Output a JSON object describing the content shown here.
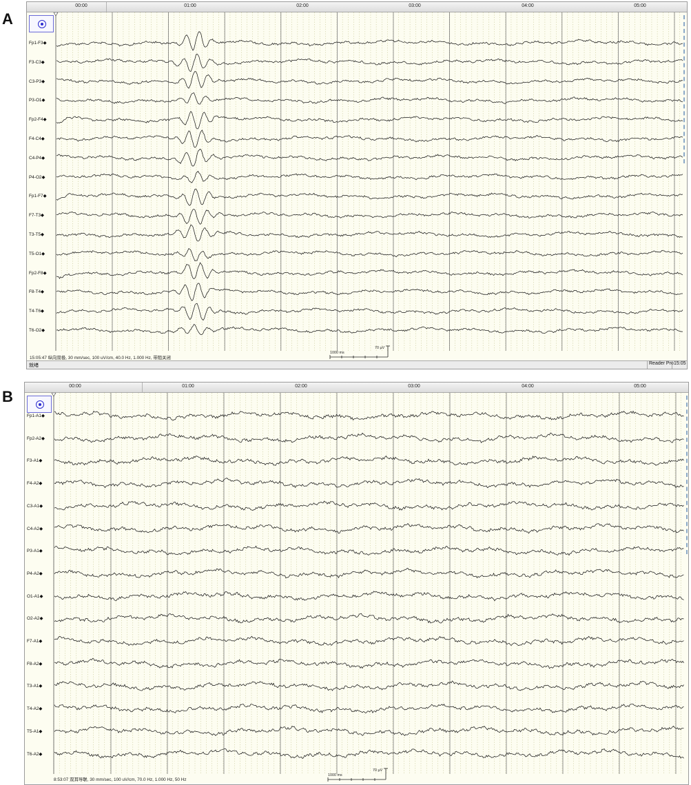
{
  "panel_a": {
    "label": "A",
    "time_ticks": [
      "00:00",
      "01:00",
      "02:00",
      "03:00",
      "04:00",
      "05:00"
    ],
    "channels": [
      "Fp1-F3◆",
      "F3-C3◆",
      "C3-P3◆",
      "P3-O1◆",
      "Fp2-F4◆",
      "F4-C4◆",
      "C4-P4◆",
      "P4-O2◆",
      "Fp1-F7◆",
      "F7-T3◆",
      "T3-T5◆",
      "T5-O1◆",
      "Fp2-F8◆",
      "F8-T4◆",
      "T4-T6◆",
      "T6-O2◆"
    ],
    "info": "15:05:47 纵向双极, 30 mm/sec, 100 uV/cm, 40.0 Hz, 1.000 Hz, 带阻关闭",
    "scale_time": "1000 ms",
    "scale_amp": "70 µV",
    "status_left": "就绪",
    "status_reader": "Reader Pro",
    "status_time": "15:05"
  },
  "panel_b": {
    "label": "B",
    "time_ticks": [
      "00:00",
      "01:00",
      "02:00",
      "03:00",
      "04:00",
      "05:00"
    ],
    "channels": [
      "Fp1-A1◆",
      "Fp2-A2◆",
      "F3-A1◆",
      "F4-A2◆",
      "C3-A1◆",
      "C4-A2◆",
      "P3-A1◆",
      "P4-A2◆",
      "O1-A1◆",
      "O2-A2◆",
      "F7-A1◆",
      "F8-A2◆",
      "T3-A1◆",
      "T4-A2◆",
      "T5-A1◆",
      "T6-A2◆"
    ],
    "info": "8:53:07 双耳导联, 30 mm/sec, 100 uV/cm, 70.0 Hz, 1.000 Hz, 50 Hz",
    "scale_time": "1000 ms",
    "scale_amp": "70 µV"
  },
  "colors": {
    "trace": "#1a1a1a",
    "background": "#fdfdf1",
    "major_grid": "#7a7a7a",
    "minor_grid": "#b9b97a",
    "settings_icon": "#2c2ccf"
  },
  "icons": {
    "settings": "target-icon",
    "marker": "triangle-marker-icon"
  }
}
